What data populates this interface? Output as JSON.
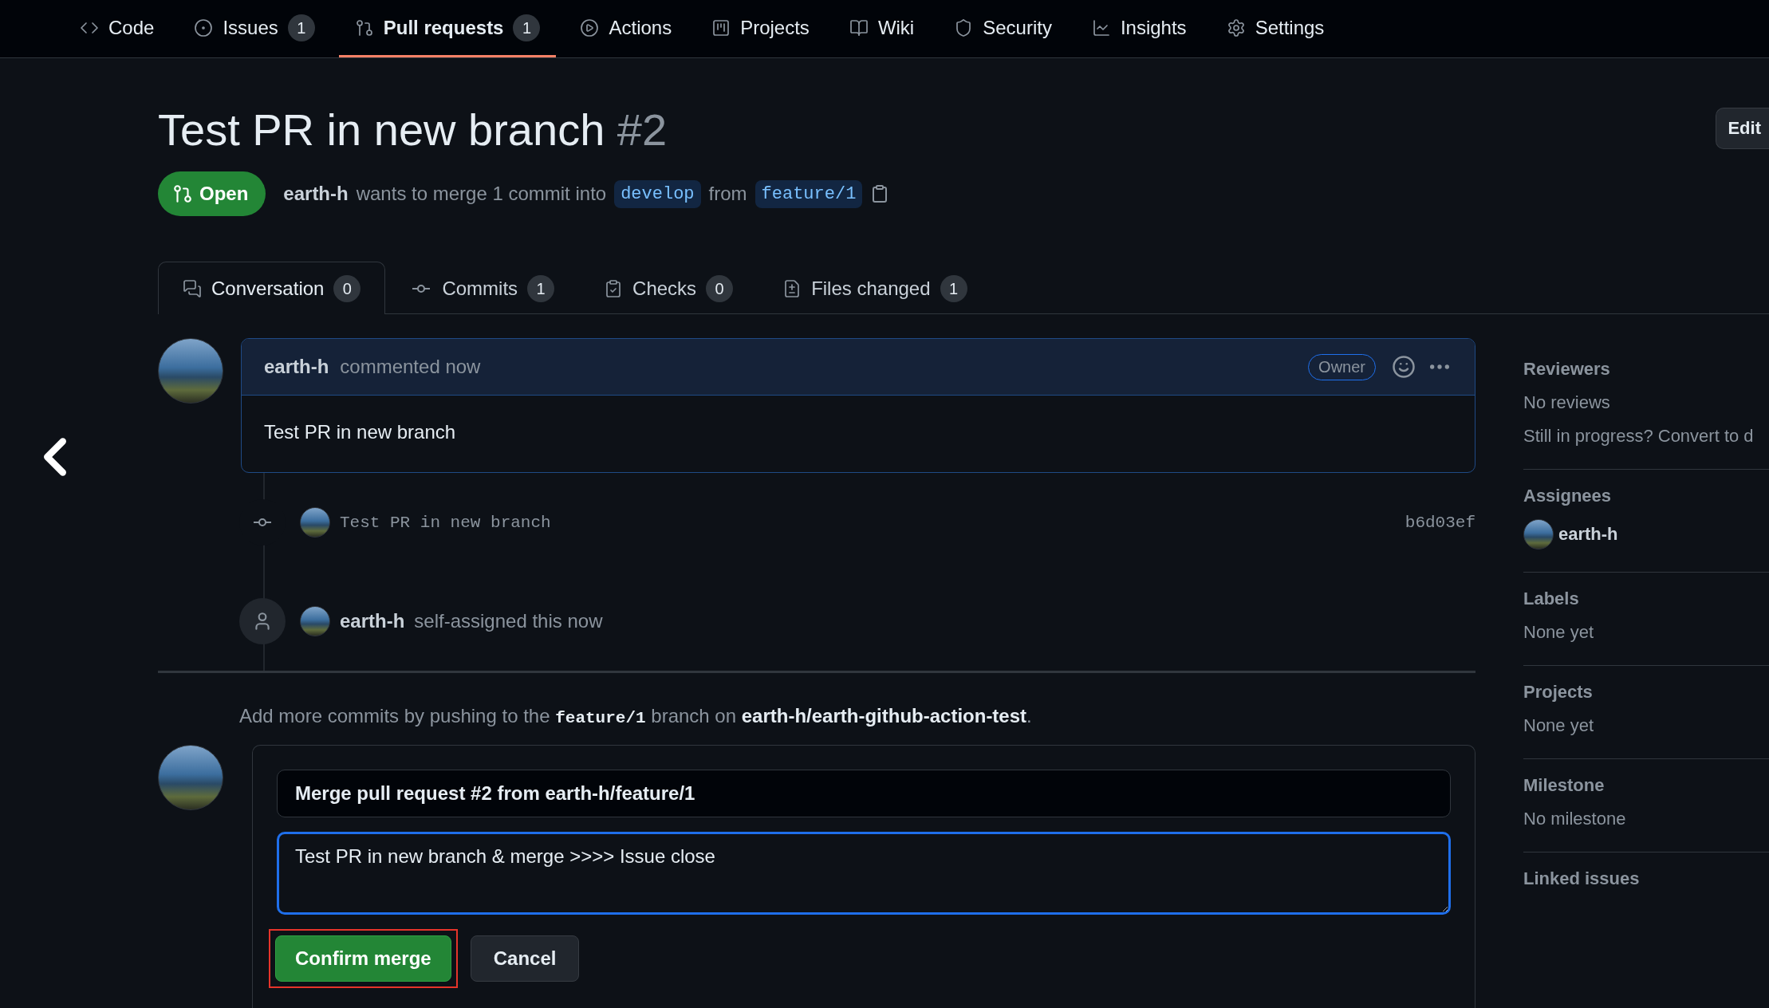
{
  "nav": [
    {
      "kind": "code",
      "label": "Code",
      "selected": false
    },
    {
      "kind": "issue",
      "label": "Issues",
      "count": "1",
      "selected": false
    },
    {
      "kind": "pull",
      "label": "Pull requests",
      "count": "1",
      "selected": true
    },
    {
      "kind": "play",
      "label": "Actions",
      "selected": false
    },
    {
      "kind": "board",
      "label": "Projects",
      "selected": false
    },
    {
      "kind": "book",
      "label": "Wiki",
      "selected": false
    },
    {
      "kind": "shield",
      "label": "Security",
      "selected": false
    },
    {
      "kind": "chart",
      "label": "Insights",
      "selected": false
    },
    {
      "kind": "gear",
      "label": "Settings",
      "selected": false
    }
  ],
  "header": {
    "title": "Test PR in new branch",
    "number": "#2",
    "edit_button": "Edit",
    "state": "Open",
    "author": "earth-h",
    "summary": "wants to merge 1 commit into",
    "base": "develop",
    "from": "from",
    "head": "feature/1"
  },
  "tabs": [
    {
      "kind": "chat",
      "label": "Conversation",
      "count": "0",
      "selected": true
    },
    {
      "kind": "commit",
      "label": "Commits",
      "count": "1",
      "selected": false
    },
    {
      "kind": "checklist",
      "label": "Checks",
      "count": "0",
      "selected": false
    },
    {
      "kind": "diff",
      "label": "Files changed",
      "count": "1",
      "selected": false
    }
  ],
  "comment": {
    "author": "earth-h",
    "action": "commented now",
    "badge": "Owner",
    "body": "Test PR in new branch"
  },
  "timeline": [
    {
      "kind": "commit",
      "message": "Test PR in new branch",
      "sha": "b6d03ef"
    },
    {
      "kind": "event",
      "actor": "earth-h",
      "text": "self-assigned this now"
    }
  ],
  "merge_hint": {
    "before": "Add more commits by pushing to the",
    "branch": "feature/1",
    "middle": "branch on",
    "repo": "earth-h/earth-github-action-test",
    "after": "."
  },
  "merge": {
    "title_value": "Merge pull request #2 from earth-h/feature/1",
    "message_value": "Test PR in new branch & merge >>>> Issue close",
    "confirm": "Confirm merge",
    "confirm_highlighted": true,
    "cancel": "Cancel"
  },
  "sidebar": [
    {
      "heading": "Reviewers",
      "lines": [
        "No reviews",
        "Still in progress? Convert to d"
      ]
    },
    {
      "heading": "Assignees",
      "users": [
        "earth-h"
      ]
    },
    {
      "heading": "Labels",
      "lines": [
        "None yet"
      ]
    },
    {
      "heading": "Projects",
      "lines": [
        "None yet"
      ]
    },
    {
      "heading": "Milestone",
      "lines": [
        "No milestone"
      ]
    },
    {
      "heading": "Linked issues"
    }
  ]
}
